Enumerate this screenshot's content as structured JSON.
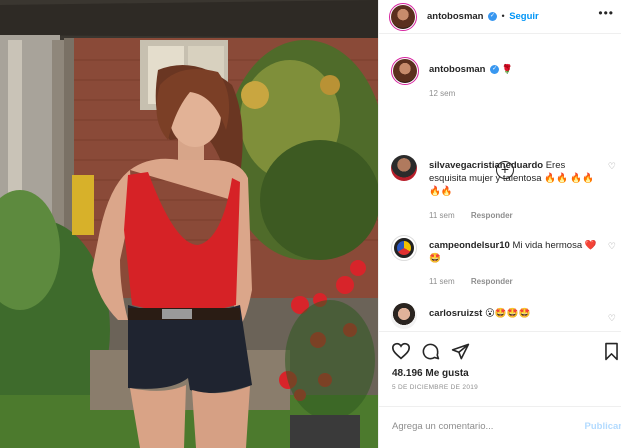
{
  "post": {
    "author": "antobosman",
    "follow_label": "Seguir",
    "more_label": "•••",
    "caption_author": "antobosman",
    "caption_emoji": "🌹",
    "caption_time": "12 sem",
    "load_more": "+"
  },
  "comments": [
    {
      "user": "silvavegacristianeduardo",
      "text": "Eres esquisita mujer y talentosa 🔥🔥 🔥🔥🔥🔥",
      "time": "11 sem",
      "reply": "Responder"
    },
    {
      "user": "campeondelsur10",
      "text": "Mi vida hermosa ❤️🤩",
      "time": "11 sem",
      "reply": "Responder"
    },
    {
      "user": "carlosruizst",
      "text": "😮🤩🤩🤩",
      "time": "",
      "reply": ""
    }
  ],
  "actions": {
    "likes": "48.196 Me gusta",
    "date": "5 DE DICIEMBRE DE 2019"
  },
  "add_comment": {
    "placeholder": "Agrega un comentario...",
    "publish": "Publicar"
  },
  "colors": {
    "link_blue": "#0095f6",
    "verified_blue": "#3897f0",
    "muted": "#8e8e8e",
    "publish_disabled": "#b3dbff"
  },
  "icons": [
    "verified-icon",
    "heart-icon",
    "comment-icon",
    "share-icon",
    "bookmark-icon",
    "more-icon",
    "add-more-icon"
  ]
}
